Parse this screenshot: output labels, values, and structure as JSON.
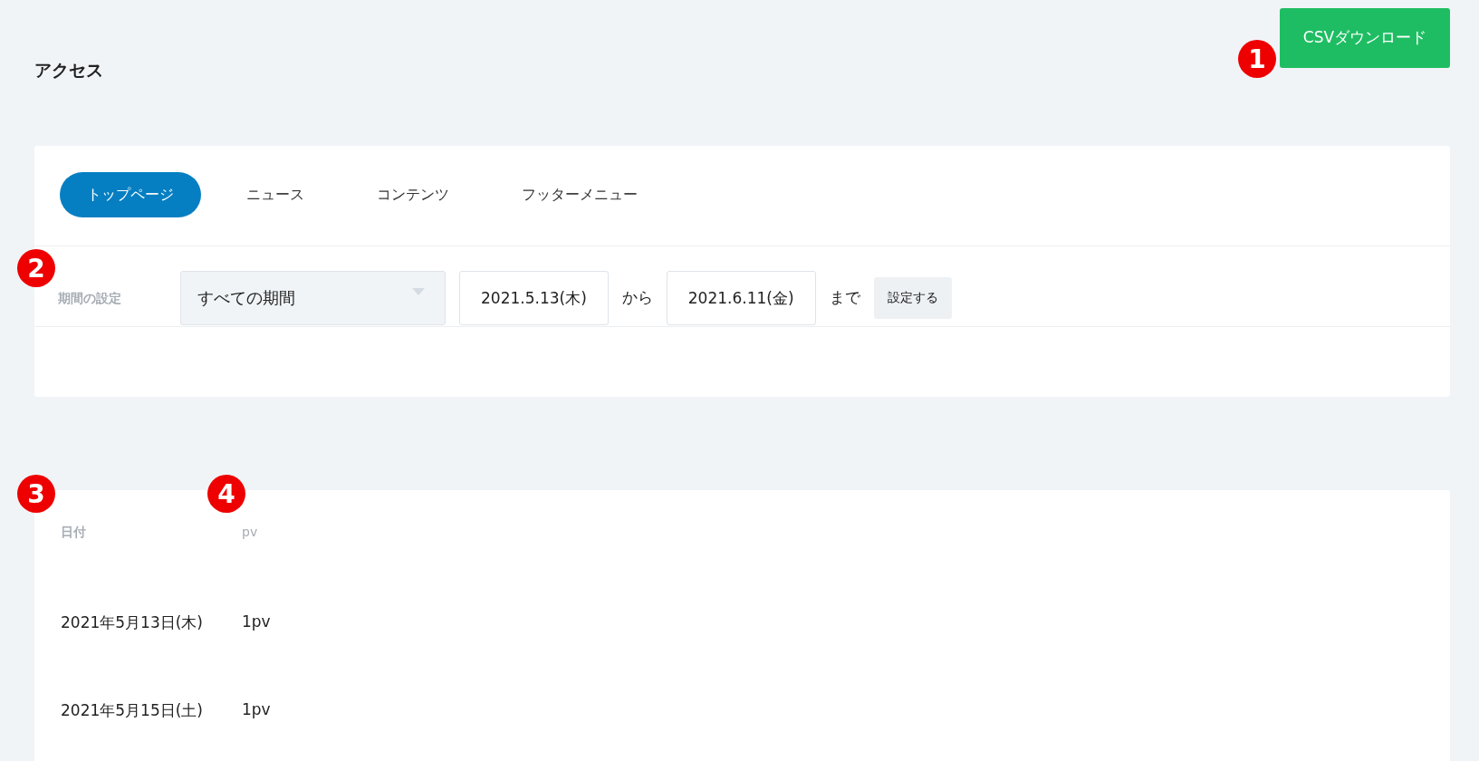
{
  "page": {
    "title": "アクセス"
  },
  "csv_button": {
    "label": "CSVダウンロード"
  },
  "tabs": [
    {
      "label": "トップページ",
      "selected": true
    },
    {
      "label": "ニュース",
      "selected": false
    },
    {
      "label": "コンテンツ",
      "selected": false
    },
    {
      "label": "フッターメニュー",
      "selected": false
    }
  ],
  "period": {
    "label": "期間の設定",
    "select": "すべての期間",
    "from": "2021.5.13(木)",
    "from_suffix": "から",
    "to": "2021.6.11(金)",
    "to_suffix": "まで",
    "apply_button": "設定する"
  },
  "table": {
    "columns": [
      "日付",
      "pv"
    ],
    "rows": [
      [
        "2021年5月13日(木)",
        "1pv"
      ],
      [
        "2021年5月15日(土)",
        "1pv"
      ]
    ]
  },
  "markers": [
    "1",
    "2",
    "3",
    "4"
  ]
}
